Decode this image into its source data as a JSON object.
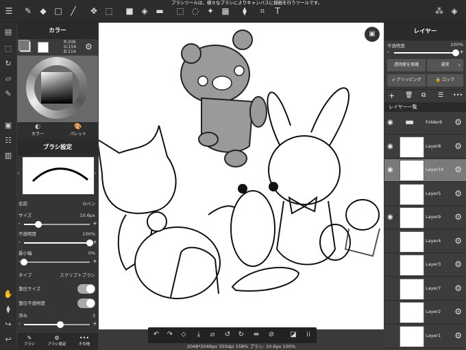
{
  "tip": "ブラシツールは、様々なブラシによりキャンバスに描画を行うツールです。",
  "color_panel": {
    "title": "カラー",
    "r": "R:206",
    "g": "G:154",
    "b": "B:114",
    "tab_color": "カラー",
    "tab_palette": "パレット"
  },
  "brush_panel": {
    "title": "ブラシ設定",
    "name_label": "名前",
    "name_value": "Gペン",
    "size_label": "サイズ",
    "size_value": "10.6px",
    "opacity_label": "不透明度",
    "opacity_value": "100%",
    "min_width_label": "最小幅",
    "min_width_value": "0%",
    "type_label": "タイプ",
    "type_value": "スクリプトブラシ",
    "pressure_size_label": "筆圧サイズ",
    "pressure_opacity_label": "筆圧不透明度",
    "blur_label": "滲み",
    "blur_value": "3",
    "size_level": 0.22,
    "opacity_level": 1.0,
    "min_width_level": 0.0,
    "blur_level": 0.55,
    "pressure_size_on": true,
    "pressure_opacity_on": true
  },
  "bottom_left_tabs": [
    "ブラシ",
    "ブラシ設定",
    "その他"
  ],
  "status": "2048*2048px 350dpi 158% ブラシ: 10.6px 100%",
  "layer_panel": {
    "title": "レイヤー",
    "opacity_label": "不透明度",
    "opacity_value": "100%",
    "opacity_level": 1.0,
    "protect_btn": "透明度を保護",
    "blend_btn": "通常",
    "clip_btn": "クリッピング",
    "lock_btn": "ロック",
    "list_title": "レイヤー一覧",
    "layers": [
      {
        "name": "Folder6",
        "visible": true,
        "selected": false
      },
      {
        "name": "Layer8",
        "visible": true,
        "selected": false
      },
      {
        "name": "Layer10",
        "visible": true,
        "selected": true
      },
      {
        "name": "Layer5",
        "visible": false,
        "selected": false
      },
      {
        "name": "Layer9",
        "visible": true,
        "selected": false
      },
      {
        "name": "Layer4",
        "visible": false,
        "selected": false
      },
      {
        "name": "Layer3",
        "visible": false,
        "selected": false
      },
      {
        "name": "Layer7",
        "visible": false,
        "selected": false
      },
      {
        "name": "Layer2",
        "visible": false,
        "selected": false
      },
      {
        "name": "Layer1",
        "visible": false,
        "selected": false
      }
    ]
  },
  "current_color": "#ce9a72"
}
